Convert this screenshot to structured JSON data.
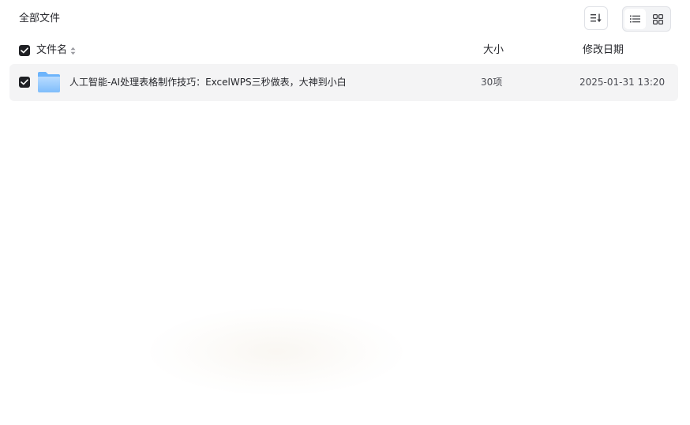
{
  "breadcrumb": {
    "title": "全部文件"
  },
  "toolbar": {
    "sort_icon": "sort-list-icon",
    "view_list_icon": "list-view-icon",
    "view_grid_icon": "grid-view-icon",
    "active_view": "list"
  },
  "table": {
    "columns": {
      "name": "文件名",
      "size": "大小",
      "date": "修改日期"
    },
    "select_all_checked": true,
    "rows": [
      {
        "checked": true,
        "type_icon": "folder-icon",
        "name": "人工智能-AI处理表格制作技巧：ExcelWPS三秒做表，大神到小白",
        "size": "30项",
        "modified": "2025-01-31 13:20"
      }
    ]
  },
  "colors": {
    "checkbox": "#1f2024",
    "row_highlight": "#f4f4f5",
    "folder_light": "#a9d3ff",
    "folder_dark": "#6db4fb"
  }
}
